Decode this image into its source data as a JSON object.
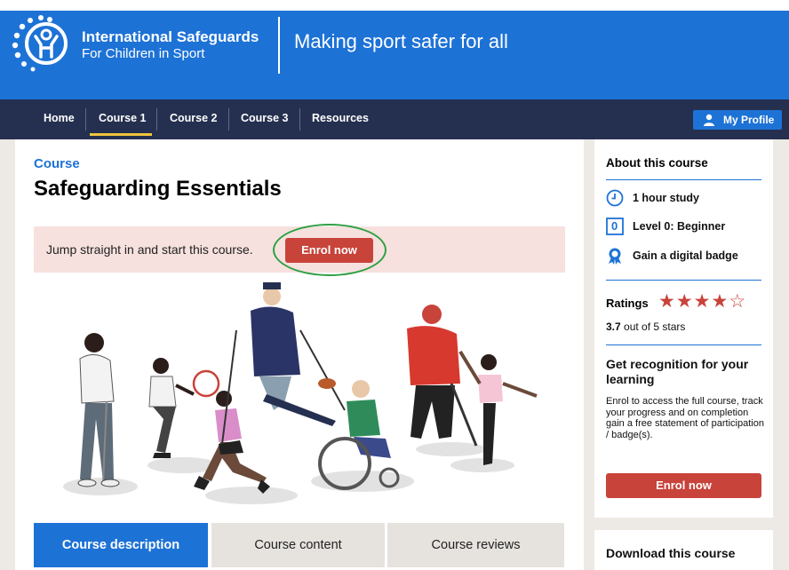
{
  "header": {
    "org_name": "International Safeguards",
    "org_sub": "For Children in Sport",
    "tagline": "Making sport safer for all",
    "brand_color": "#1d72d6"
  },
  "nav": {
    "items": [
      {
        "label": "Home",
        "active": false
      },
      {
        "label": "Course 1",
        "active": true
      },
      {
        "label": "Course 2",
        "active": false
      },
      {
        "label": "Course 3",
        "active": false
      },
      {
        "label": "Resources",
        "active": false
      }
    ],
    "profile_label": "My Profile",
    "background": "#253050",
    "active_color": "#f2c53d"
  },
  "main": {
    "eyebrow": "Course",
    "title": "Safeguarding Essentials",
    "banner_text": "Jump straight in and start this course.",
    "enrol_label": "Enrol now",
    "tabs": [
      {
        "label": "Course description",
        "active": true
      },
      {
        "label": "Course content",
        "active": false
      },
      {
        "label": "Course reviews",
        "active": false
      }
    ]
  },
  "sidebar": {
    "about_heading": "About this course",
    "facts": [
      {
        "icon": "clock-icon",
        "label": "1 hour study"
      },
      {
        "icon": "level-icon",
        "icon_text": "0",
        "label": "Level 0: Beginner"
      },
      {
        "icon": "badge-icon",
        "label": "Gain a digital badge"
      }
    ],
    "ratings_heading": "Ratings",
    "rating_value": 3.7,
    "rating_filled_stars": 4,
    "rating_max": 5,
    "rating_number": "3.7",
    "rating_suffix": " out of 5 stars",
    "recog_heading": "Get recognition for your learning",
    "recog_body": "Enrol to access the full course, track your progress and on completion gain a free statement of participation / badge(s).",
    "enrol_label": "Enrol now",
    "download_heading": "Download this course",
    "accent_color": "#c8433a"
  }
}
